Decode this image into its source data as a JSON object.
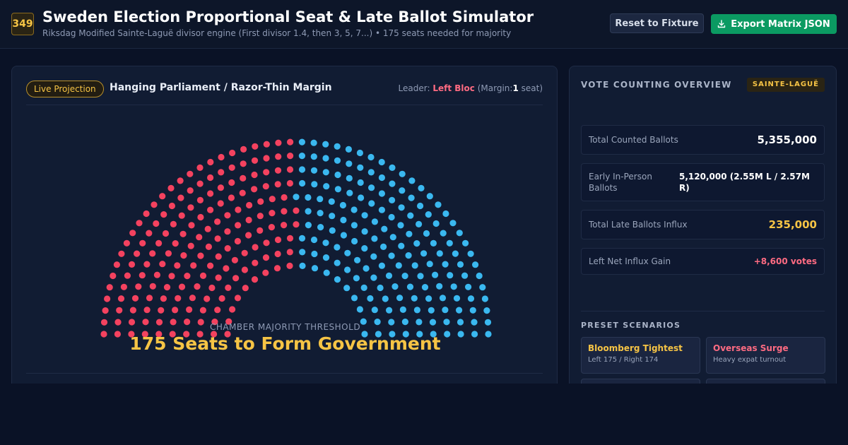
{
  "header": {
    "badge": "349",
    "title": "Sweden Election Proportional Seat & Late Ballot Simulator",
    "subtitle": "Riksdag Modified Sainte-Laguë divisor engine (First divisor 1.4, then 3, 5, 7...) • 175 seats needed for majority",
    "reset_label": "Reset to Fixture",
    "export_label": "Export Matrix JSON"
  },
  "projection": {
    "badge": "Live Projection",
    "status": "Hanging Parliament / Razor-Thin Margin",
    "leader_prefix": "Leader:",
    "leader_name": "Left Bloc",
    "margin_prefix": "(Margin:",
    "margin_value": "1",
    "margin_suffix": "seat)",
    "threshold_label": "CHAMBER MAJORITY THRESHOLD",
    "threshold_value": "175 Seats to Form Government"
  },
  "chamber": {
    "total_seats": 349,
    "left_seats": 175,
    "right_seats": 174,
    "left_color": "#f4425f",
    "right_color": "#3ab8f0"
  },
  "overview": {
    "title": "VOTE COUNTING OVERVIEW",
    "method": "SAINTE-LAGUË",
    "stats": [
      {
        "label": "Total Counted Ballots",
        "value": "5,355,000"
      },
      {
        "label": "Early In-Person Ballots",
        "value": "5,120,000 (2.55M L / 2.57M R)"
      },
      {
        "label": "Total Late Ballots Influx",
        "value": "235,000"
      },
      {
        "label": "Left Net Influx Gain",
        "value": "+8,600 votes"
      }
    ],
    "presets_title": "PRESET SCENARIOS",
    "presets": [
      {
        "name": "Bloomberg Tightest",
        "desc": "Left 175 / Right 174",
        "color": "#f6c445"
      },
      {
        "name": "Overseas Surge",
        "desc": "Heavy expat turnout",
        "color": "#ff6b82"
      }
    ]
  }
}
